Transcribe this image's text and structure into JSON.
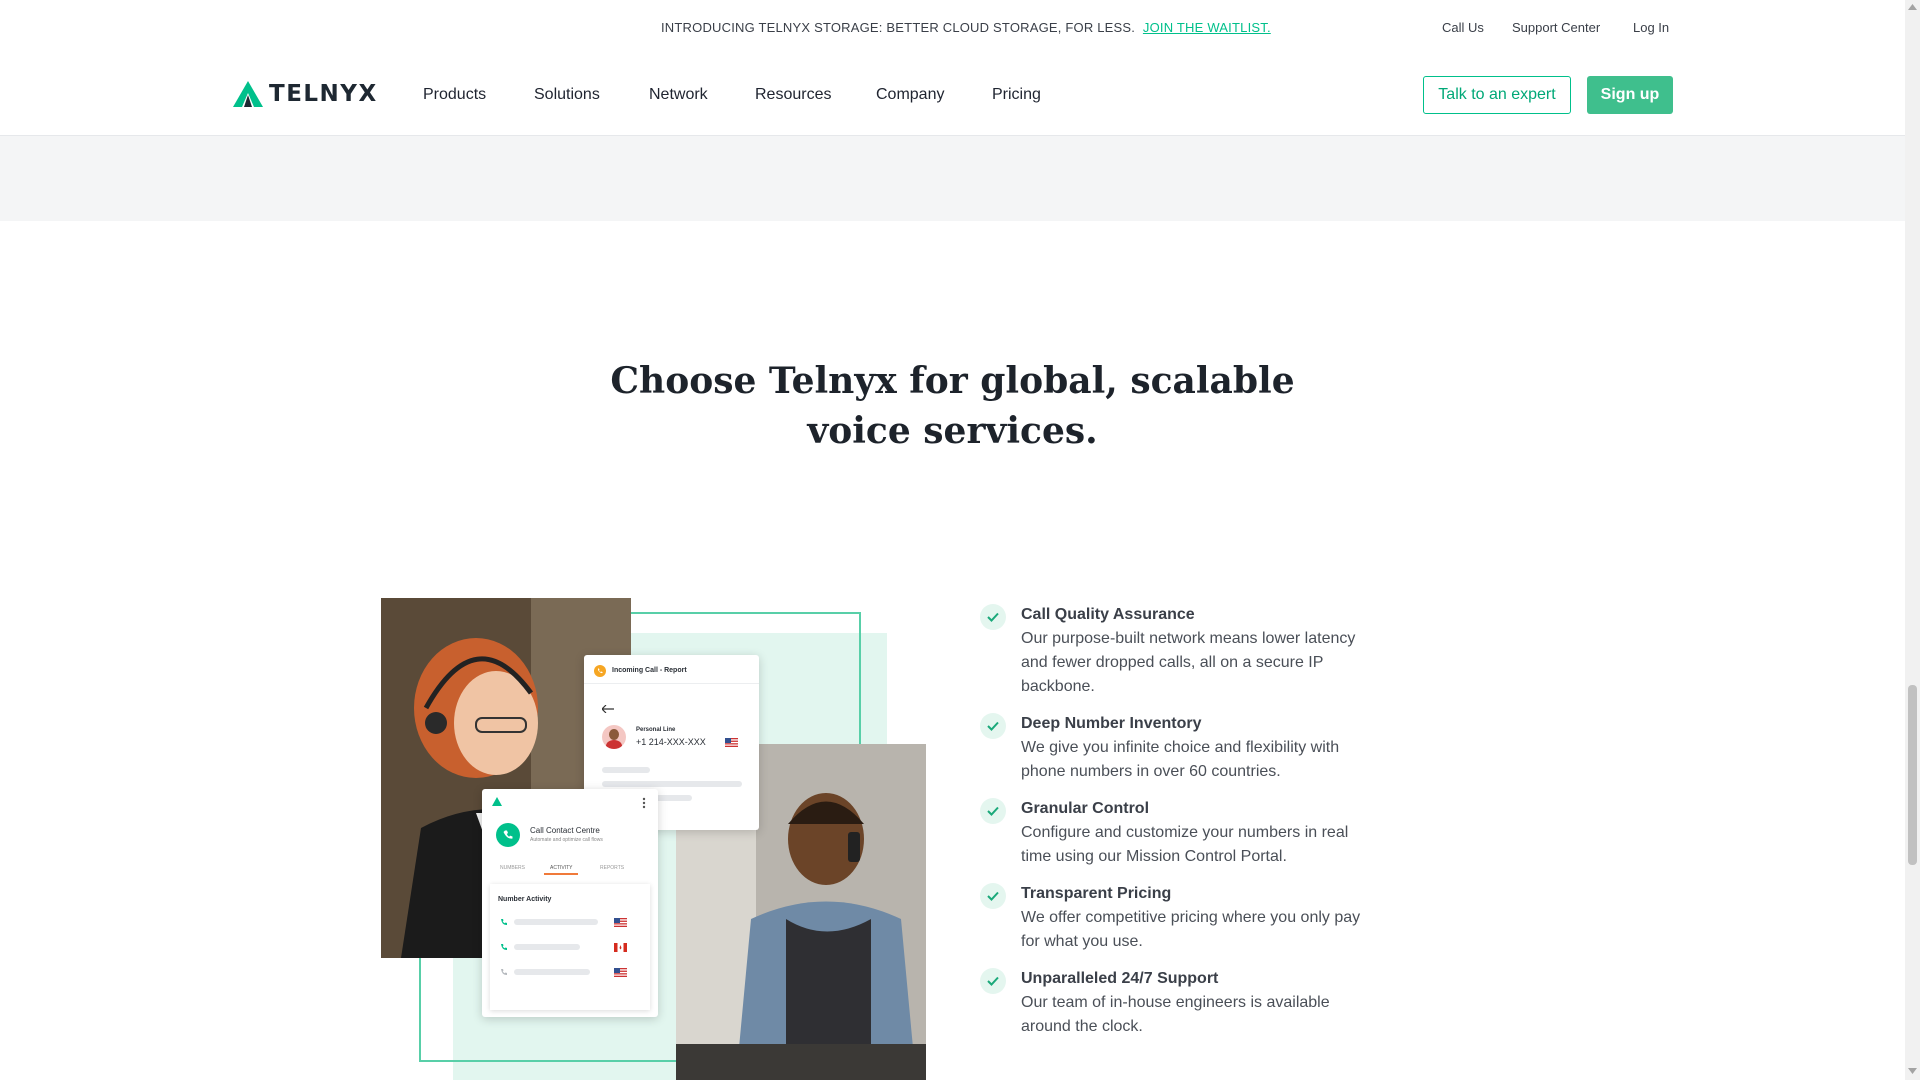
{
  "announcement": {
    "text": "INTRODUCING TELNYX STORAGE: BETTER CLOUD STORAGE, FOR LESS.",
    "link": "JOIN THE WAITLIST."
  },
  "utility_links": [
    "Call Us",
    "Support Center",
    "Log In"
  ],
  "brand": {
    "name": "TELNYX",
    "accent": "#00c08b"
  },
  "nav": {
    "items": [
      "Products",
      "Solutions",
      "Network",
      "Resources",
      "Company",
      "Pricing"
    ],
    "cta_outline": "Talk to an expert",
    "cta_solid": "Sign up"
  },
  "headline": {
    "line1": "Choose Telnyx for global, scalable",
    "line2": "voice services."
  },
  "collage": {
    "report_card": {
      "title": "Incoming Call - Report",
      "line_label": "Personal Line",
      "number": "+1 214-XXX-XXX"
    },
    "contact_card": {
      "title": "Call Contact Centre",
      "subtitle": "Automate and optimize call flows",
      "tabs": [
        "NUMBERS",
        "ACTIVITY",
        "REPORTS"
      ],
      "section": "Number Activity"
    }
  },
  "features": [
    {
      "title": "Call Quality Assurance",
      "desc": "Our purpose-built network means lower latency and fewer dropped calls, all on a secure IP backbone."
    },
    {
      "title": "Deep Number Inventory",
      "desc": "We give you infinite choice and flexibility with phone numbers in over 60 countries."
    },
    {
      "title": "Granular Control",
      "desc": "Configure and customize your numbers in real time using our Mission Control Portal."
    },
    {
      "title": "Transparent Pricing",
      "desc": "We offer competitive pricing where you only pay for what you use."
    },
    {
      "title": "Unparalleled 24/7 Support",
      "desc": "Our team of in-house engineers is available around the clock."
    }
  ],
  "icons": {
    "check": "check-icon",
    "phone": "phone-icon",
    "back": "back-arrow-icon",
    "menu": "kebab-menu-icon"
  }
}
